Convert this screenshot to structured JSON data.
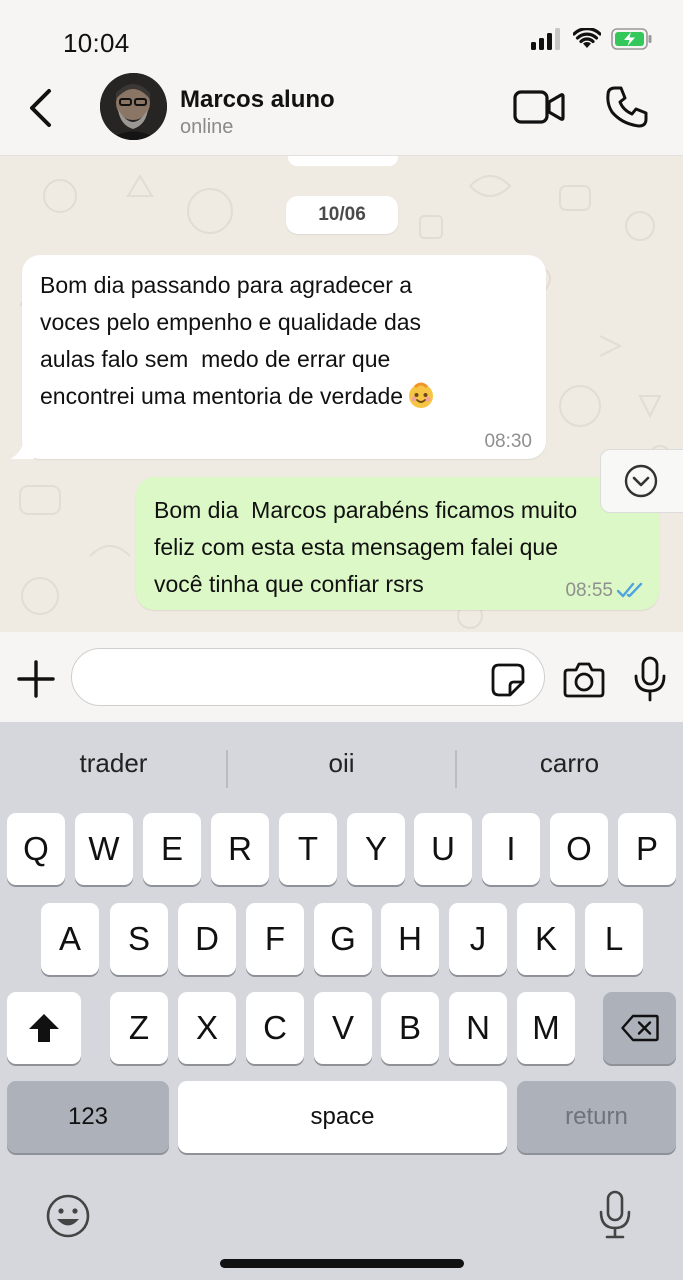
{
  "status_bar": {
    "time": "10:04",
    "icons": [
      "signal-icon",
      "wifi-icon",
      "battery-charging-icon"
    ],
    "battery_color": "#34c759"
  },
  "header": {
    "contact_name": "Marcos aluno",
    "contact_status": "online",
    "icons": [
      "back-icon",
      "video-call-icon",
      "phone-icon"
    ]
  },
  "chat": {
    "date_label": "10/06",
    "messages": [
      {
        "direction": "incoming",
        "text": "Bom dia passando para agradecer a\nvoces pelo empenho e qualidade das\naulas falo sem  medo de errar que\nencontrei uma mentoria de verdade",
        "emoji": "smiling-face-emoji",
        "time": "08:30"
      },
      {
        "direction": "outgoing",
        "text": "Bom dia  Marcos parabéns ficamos muito\nfeliz com esta esta mensagem falei que\nvocê tinha que confiar rsrs",
        "time": "08:55",
        "status": "read",
        "receipt_color": "#4fa3e0"
      }
    ],
    "colors": {
      "incoming_bubble": "#ffffff",
      "outgoing_bubble": "#dcf8c6",
      "wallpaper": "#efeae2"
    }
  },
  "composer": {
    "placeholder": "",
    "value": "",
    "icons": [
      "plus-icon",
      "sticker-icon",
      "camera-icon",
      "mic-icon"
    ]
  },
  "keyboard": {
    "suggestions": [
      "trader",
      "oii",
      "carro"
    ],
    "row1": [
      "Q",
      "W",
      "E",
      "R",
      "T",
      "Y",
      "U",
      "I",
      "O",
      "P"
    ],
    "row2": [
      "A",
      "S",
      "D",
      "F",
      "G",
      "H",
      "J",
      "K",
      "L"
    ],
    "row3": [
      "Z",
      "X",
      "C",
      "V",
      "B",
      "N",
      "M"
    ],
    "numbers_label": "123",
    "space_label": "space",
    "return_label": "return",
    "icons": [
      "shift-icon",
      "backspace-icon",
      "emoji-icon",
      "dictation-icon"
    ]
  }
}
